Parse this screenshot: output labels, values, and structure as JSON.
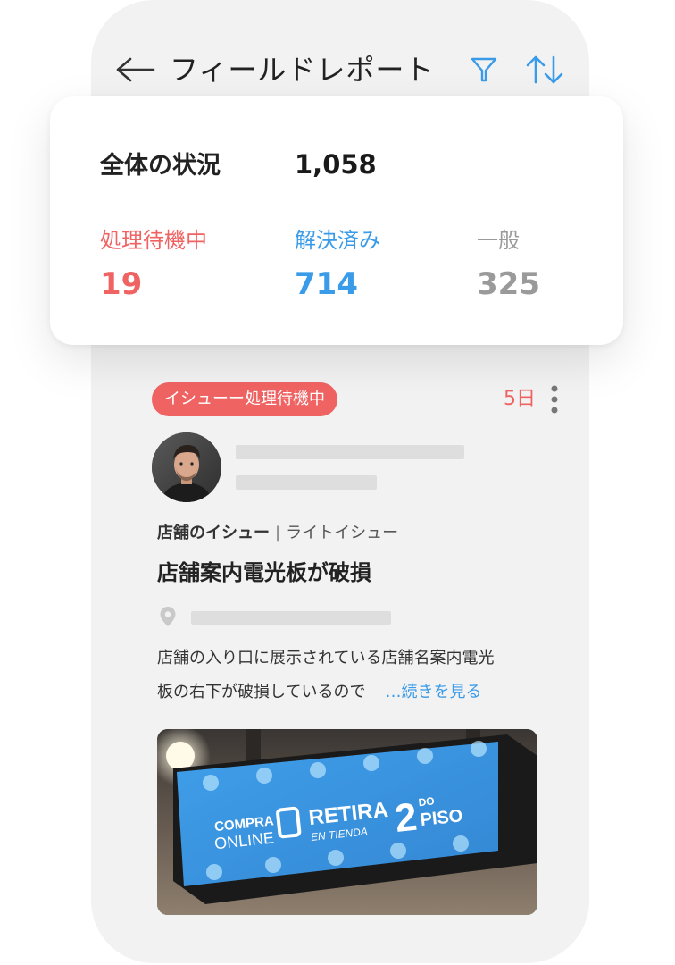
{
  "header": {
    "title": "フィールドレポート",
    "back_icon": "arrow-left-icon",
    "filter_icon": "filter-icon",
    "sort_icon": "sort-icon"
  },
  "summary": {
    "label": "全体の状況",
    "total": "1,058",
    "stats": [
      {
        "label": "処理待機中",
        "value": "19",
        "color": "#f06363"
      },
      {
        "label": "解決済み",
        "value": "714",
        "color": "#3a9be8"
      },
      {
        "label": "一般",
        "value": "325",
        "color": "#9a9a9a"
      }
    ]
  },
  "card": {
    "badge": "イシューー処理待機中",
    "days": "5日",
    "category": "店舗のイシュー",
    "subcategory": "ライトイシュー",
    "title": "店舗案内電光板が破損",
    "description_line1": "店舗の入り口に展示されている店舗名案内電光",
    "description_line2": "板の右下が破損しているので",
    "more_link": "…続きを見る",
    "sign": {
      "text1": "COMPRA",
      "text2": "ONLINE",
      "text3": "RETIRA",
      "text4": "EN TIENDA",
      "text5": "2",
      "text6": "DO",
      "text7": "PISO"
    }
  },
  "colors": {
    "accent_blue": "#3a9be8",
    "pending_red": "#f06363",
    "neutral_gray": "#9a9a9a"
  }
}
